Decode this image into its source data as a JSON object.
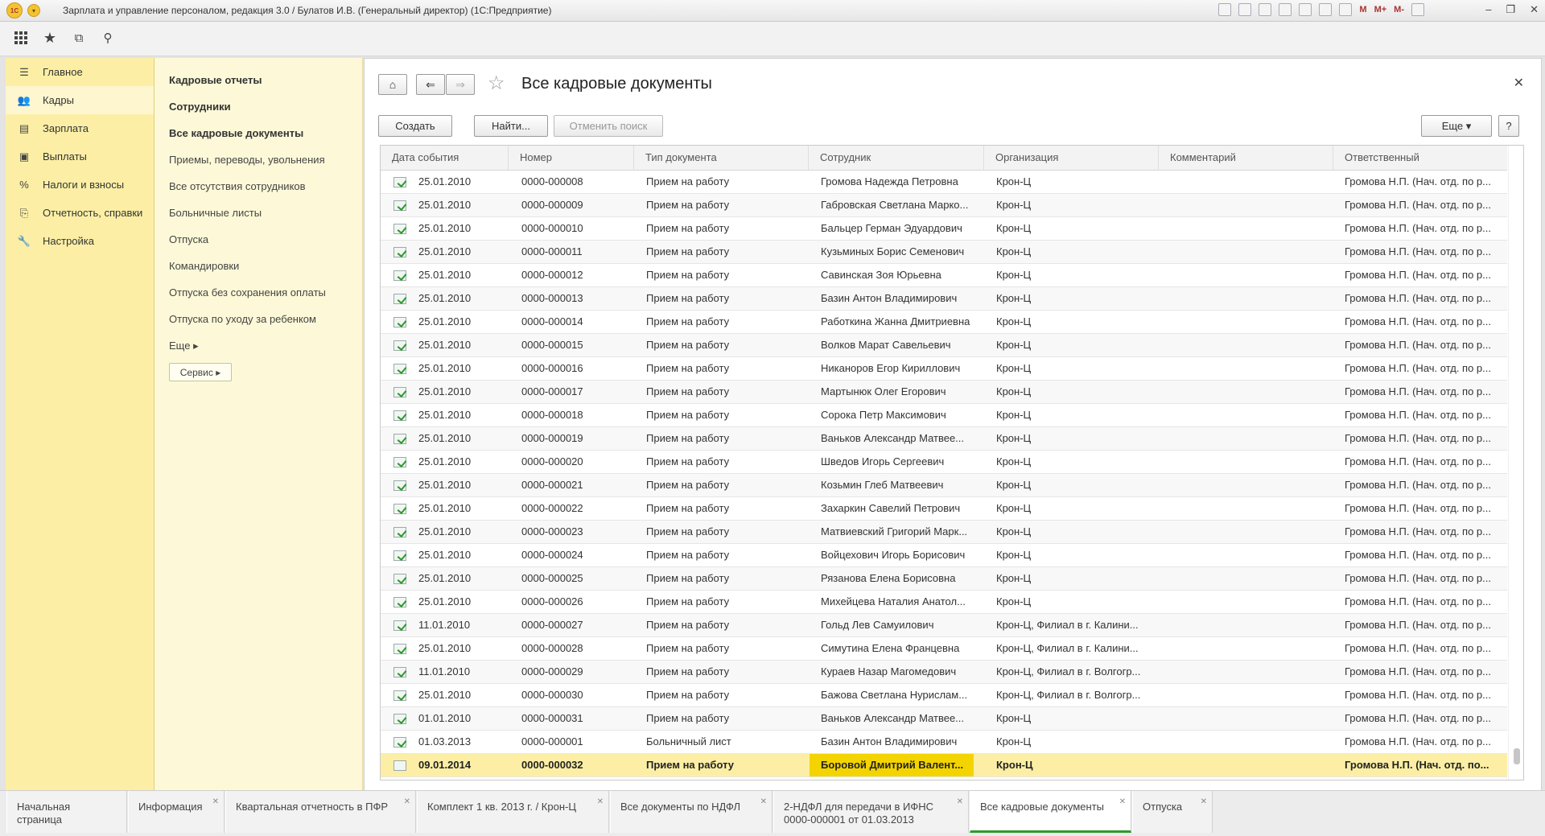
{
  "window": {
    "title": "Зарплата и управление персоналом, редакция 3.0 / Булатов И.В. (Генеральный директор)  (1С:Предприятие)",
    "logo": "1С",
    "m_labels": [
      "M",
      "M+",
      "M-"
    ],
    "controls": [
      "–",
      "❐",
      "✕"
    ]
  },
  "sidebar": {
    "items": [
      {
        "label": "Главное",
        "icon": "list-icon",
        "glyph": "☰"
      },
      {
        "label": "Кадры",
        "icon": "users-icon",
        "glyph": "👥"
      },
      {
        "label": "Зарплата",
        "icon": "salary-icon",
        "glyph": "▤"
      },
      {
        "label": "Выплаты",
        "icon": "payments-icon",
        "glyph": "▣"
      },
      {
        "label": "Налоги и взносы",
        "icon": "percent-icon",
        "glyph": "%"
      },
      {
        "label": "Отчетность, справки",
        "icon": "reports-icon",
        "glyph": "⎘"
      },
      {
        "label": "Настройка",
        "icon": "wrench-icon",
        "glyph": "🔧"
      }
    ]
  },
  "nav2": {
    "items": [
      {
        "label": "Кадровые отчеты",
        "bold": true
      },
      {
        "label": "Сотрудники",
        "bold": true
      },
      {
        "label": "Все кадровые документы",
        "bold": true
      },
      {
        "label": "Приемы, переводы, увольнения",
        "bold": false
      },
      {
        "label": "Все отсутствия сотрудников",
        "bold": false
      },
      {
        "label": "Больничные листы",
        "bold": false
      },
      {
        "label": "Отпуска",
        "bold": false
      },
      {
        "label": "Командировки",
        "bold": false
      },
      {
        "label": "Отпуска без сохранения оплаты",
        "bold": false
      },
      {
        "label": "Отпуска по уходу за ребенком",
        "bold": false
      },
      {
        "label": "Еще ▸",
        "bold": false
      }
    ],
    "service_label": "Сервис ▸"
  },
  "main": {
    "title": "Все кадровые документы",
    "create_label": "Создать",
    "find_label": "Найти...",
    "cancel_search_label": "Отменить поиск",
    "more_label": "Еще ▾",
    "help_label": "?"
  },
  "table": {
    "columns": [
      "Дата события",
      "Номер",
      "Тип документа",
      "Сотрудник",
      "Организация",
      "Комментарий",
      "Ответственный"
    ],
    "rows": [
      {
        "date": "25.01.2010",
        "num": "0000-000008",
        "type": "Прием на работу",
        "emp": "Громова Надежда Петровна",
        "org": "Крон-Ц",
        "comment": "",
        "resp": "Громова Н.П. (Нач. отд. по р..."
      },
      {
        "date": "25.01.2010",
        "num": "0000-000009",
        "type": "Прием на работу",
        "emp": "Габровская Светлана Марко...",
        "org": "Крон-Ц",
        "comment": "",
        "resp": "Громова Н.П. (Нач. отд. по р..."
      },
      {
        "date": "25.01.2010",
        "num": "0000-000010",
        "type": "Прием на работу",
        "emp": "Бальцер Герман Эдуардович",
        "org": "Крон-Ц",
        "comment": "",
        "resp": "Громова Н.П. (Нач. отд. по р..."
      },
      {
        "date": "25.01.2010",
        "num": "0000-000011",
        "type": "Прием на работу",
        "emp": "Кузьминых Борис Семенович",
        "org": "Крон-Ц",
        "comment": "",
        "resp": "Громова Н.П. (Нач. отд. по р..."
      },
      {
        "date": "25.01.2010",
        "num": "0000-000012",
        "type": "Прием на работу",
        "emp": "Савинская Зоя Юрьевна",
        "org": "Крон-Ц",
        "comment": "",
        "resp": "Громова Н.П. (Нач. отд. по р..."
      },
      {
        "date": "25.01.2010",
        "num": "0000-000013",
        "type": "Прием на работу",
        "emp": "Базин Антон Владимирович",
        "org": "Крон-Ц",
        "comment": "",
        "resp": "Громова Н.П. (Нач. отд. по р..."
      },
      {
        "date": "25.01.2010",
        "num": "0000-000014",
        "type": "Прием на работу",
        "emp": "Работкина Жанна Дмитриевна",
        "org": "Крон-Ц",
        "comment": "",
        "resp": "Громова Н.П. (Нач. отд. по р..."
      },
      {
        "date": "25.01.2010",
        "num": "0000-000015",
        "type": "Прием на работу",
        "emp": "Волков Марат Савельевич",
        "org": "Крон-Ц",
        "comment": "",
        "resp": "Громова Н.П. (Нач. отд. по р..."
      },
      {
        "date": "25.01.2010",
        "num": "0000-000016",
        "type": "Прием на работу",
        "emp": "Никаноров Егор Кириллович",
        "org": "Крон-Ц",
        "comment": "",
        "resp": "Громова Н.П. (Нач. отд. по р..."
      },
      {
        "date": "25.01.2010",
        "num": "0000-000017",
        "type": "Прием на работу",
        "emp": "Мартынюк Олег Егорович",
        "org": "Крон-Ц",
        "comment": "",
        "resp": "Громова Н.П. (Нач. отд. по р..."
      },
      {
        "date": "25.01.2010",
        "num": "0000-000018",
        "type": "Прием на работу",
        "emp": "Сорока Петр Максимович",
        "org": "Крон-Ц",
        "comment": "",
        "resp": "Громова Н.П. (Нач. отд. по р..."
      },
      {
        "date": "25.01.2010",
        "num": "0000-000019",
        "type": "Прием на работу",
        "emp": "Ваньков Александр Матвее...",
        "org": "Крон-Ц",
        "comment": "",
        "resp": "Громова Н.П. (Нач. отд. по р..."
      },
      {
        "date": "25.01.2010",
        "num": "0000-000020",
        "type": "Прием на работу",
        "emp": "Шведов Игорь Сергеевич",
        "org": "Крон-Ц",
        "comment": "",
        "resp": "Громова Н.П. (Нач. отд. по р..."
      },
      {
        "date": "25.01.2010",
        "num": "0000-000021",
        "type": "Прием на работу",
        "emp": "Козьмин Глеб Матвеевич",
        "org": "Крон-Ц",
        "comment": "",
        "resp": "Громова Н.П. (Нач. отд. по р..."
      },
      {
        "date": "25.01.2010",
        "num": "0000-000022",
        "type": "Прием на работу",
        "emp": "Захаркин Савелий Петрович",
        "org": "Крон-Ц",
        "comment": "",
        "resp": "Громова Н.П. (Нач. отд. по р..."
      },
      {
        "date": "25.01.2010",
        "num": "0000-000023",
        "type": "Прием на работу",
        "emp": "Матвиевский Григорий Марк...",
        "org": "Крон-Ц",
        "comment": "",
        "resp": "Громова Н.П. (Нач. отд. по р..."
      },
      {
        "date": "25.01.2010",
        "num": "0000-000024",
        "type": "Прием на работу",
        "emp": "Войцехович Игорь Борисович",
        "org": "Крон-Ц",
        "comment": "",
        "resp": "Громова Н.П. (Нач. отд. по р..."
      },
      {
        "date": "25.01.2010",
        "num": "0000-000025",
        "type": "Прием на работу",
        "emp": "Рязанова Елена Борисовна",
        "org": "Крон-Ц",
        "comment": "",
        "resp": "Громова Н.П. (Нач. отд. по р..."
      },
      {
        "date": "25.01.2010",
        "num": "0000-000026",
        "type": "Прием на работу",
        "emp": "Михейцева Наталия Анатол...",
        "org": "Крон-Ц",
        "comment": "",
        "resp": "Громова Н.П. (Нач. отд. по р..."
      },
      {
        "date": "11.01.2010",
        "num": "0000-000027",
        "type": "Прием на работу",
        "emp": "Гольд Лев Самуилович",
        "org": "Крон-Ц, Филиал в г. Калини...",
        "comment": "",
        "resp": "Громова Н.П. (Нач. отд. по р..."
      },
      {
        "date": "25.01.2010",
        "num": "0000-000028",
        "type": "Прием на работу",
        "emp": "Симутина Елена Францевна",
        "org": "Крон-Ц, Филиал в г. Калини...",
        "comment": "",
        "resp": "Громова Н.П. (Нач. отд. по р..."
      },
      {
        "date": "11.01.2010",
        "num": "0000-000029",
        "type": "Прием на работу",
        "emp": "Кураев Назар Магомедович",
        "org": "Крон-Ц, Филиал в г. Волгогр...",
        "comment": "",
        "resp": "Громова Н.П. (Нач. отд. по р..."
      },
      {
        "date": "25.01.2010",
        "num": "0000-000030",
        "type": "Прием на работу",
        "emp": "Бажова Светлана Нурислам...",
        "org": "Крон-Ц, Филиал в г. Волгогр...",
        "comment": "",
        "resp": "Громова Н.П. (Нач. отд. по р..."
      },
      {
        "date": "01.01.2010",
        "num": "0000-000031",
        "type": "Прием на работу",
        "emp": "Ваньков Александр Матвее...",
        "org": "Крон-Ц",
        "comment": "",
        "resp": "Громова Н.П. (Нач. отд. по р..."
      },
      {
        "date": "01.03.2013",
        "num": "0000-000001",
        "type": "Больничный лист",
        "emp": "Базин Антон Владимирович",
        "org": "Крон-Ц",
        "comment": "",
        "resp": "Громова Н.П. (Нач. отд. по р..."
      },
      {
        "date": "09.01.2014",
        "num": "0000-000032",
        "type": "Прием на работу",
        "emp": "Боровой Дмитрий Валент...",
        "org": "Крон-Ц",
        "comment": "",
        "resp": "Громова Н.П. (Нач. отд. по...",
        "selected": true
      }
    ]
  },
  "tabs": [
    {
      "label": "Начальная страница",
      "closable": false
    },
    {
      "label": "Информация",
      "closable": true
    },
    {
      "label": "Квартальная отчетность в ПФР",
      "closable": true
    },
    {
      "label": "Комплект 1 кв. 2013 г. / Крон-Ц",
      "closable": true
    },
    {
      "label": "Все документы по НДФЛ",
      "closable": true
    },
    {
      "label": "2-НДФЛ для передачи в ИФНС 0000-000001 от 01.03.2013",
      "closable": true
    },
    {
      "label": "Все кадровые документы",
      "closable": true,
      "active": true
    },
    {
      "label": "Отпуска",
      "closable": true
    }
  ],
  "colors": {
    "sidebar": "#fcefa5",
    "selected_row": "#fcefa5",
    "selected_cell": "#f4d400",
    "check": "#2c9a2c"
  }
}
